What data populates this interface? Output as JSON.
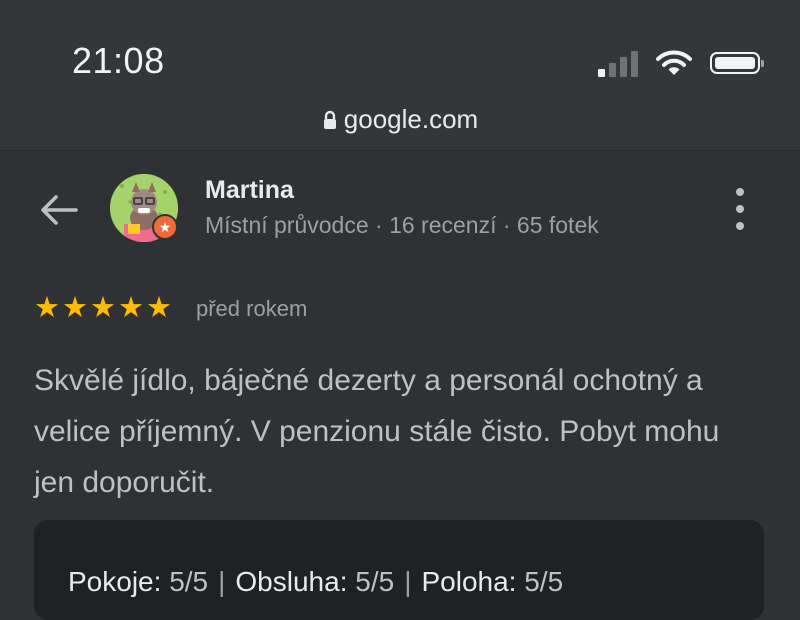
{
  "status_bar": {
    "time": "21:08",
    "url": "google.com"
  },
  "reviewer": {
    "name": "Martina",
    "meta": "Místní průvodce · 16 recenzí · 65 fotek"
  },
  "review": {
    "rating": 5,
    "max_rating": 5,
    "posted": "před rokem",
    "text": "Skvělé jídlo, báječné dezerty a personál ochotný a velice příjemný. V penzionu stále čisto. Pobyt mohu jen doporučit."
  },
  "ratings": [
    {
      "label": "Pokoje:",
      "value": "5/5"
    },
    {
      "label": "Obsluha:",
      "value": "5/5"
    },
    {
      "label": "Poloha:",
      "value": "5/5"
    }
  ],
  "colors": {
    "background": "#303134",
    "star": "#fbbc04",
    "card": "#202124",
    "badge": "#ef6c3a"
  },
  "icons": {
    "back": "arrow-left-icon",
    "more": "more-vertical-icon",
    "lock": "lock-icon",
    "wifi": "wifi-icon",
    "signal": "signal-icon",
    "battery": "battery-icon",
    "local_guide": "star-badge-icon"
  }
}
